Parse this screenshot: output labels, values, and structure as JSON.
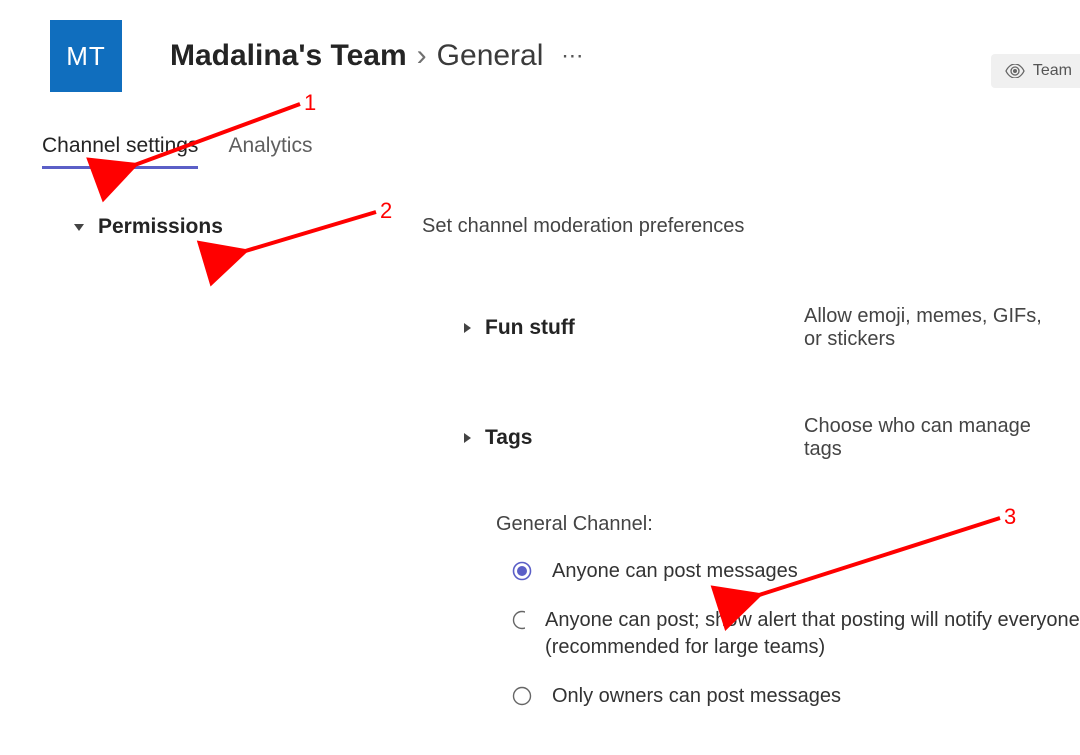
{
  "header": {
    "avatar_initials": "MT",
    "team_name": "Madalina's Team",
    "channel_name": "General",
    "more_label": "⋯",
    "team_pill_label": "Team"
  },
  "tabs": {
    "channel_settings": "Channel settings",
    "analytics": "Analytics"
  },
  "permissions": {
    "title": "Permissions",
    "description": "Set channel moderation preferences",
    "fun_stuff": {
      "title": "Fun stuff",
      "description": "Allow emoji, memes, GIFs, or stickers"
    },
    "tags": {
      "title": "Tags",
      "description": "Choose who can manage tags"
    },
    "general_channel_label": "General Channel:",
    "radios": {
      "anyone": "Anyone can post messages",
      "anyone_alert": "Anyone can post; show alert that posting will notify everyone (recommended for large teams)",
      "owners": "Only owners can post messages"
    }
  },
  "annotations": {
    "a1": "1",
    "a2": "2",
    "a3": "3"
  }
}
